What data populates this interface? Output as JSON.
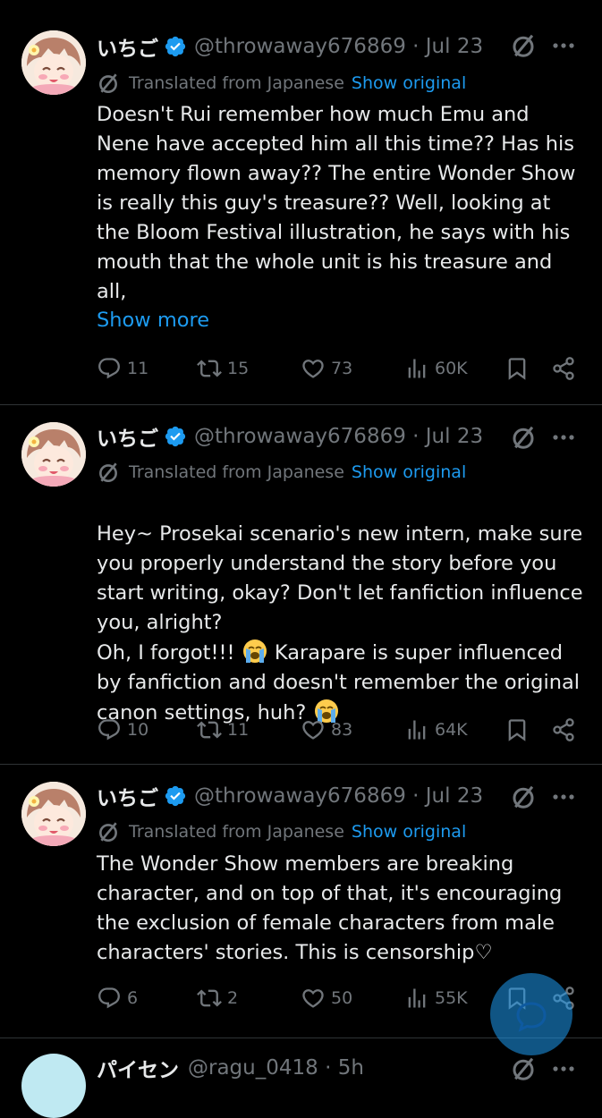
{
  "tweets": [
    {
      "name": "いちご",
      "handle": "@throwaway676869 · Jul 23",
      "translated": "Translated from Japanese",
      "show_original": "Show original",
      "body": "Doesn't Rui remember how much Emu and Nene have accepted him all this time?? Has his memory flown away?? The entire Wonder Show is really this guy's treasure?? Well, looking at the Bloom Festival illustration, he says with his mouth that the whole unit is his treasure and all,",
      "show_more": "Show more",
      "replies": "11",
      "reposts": "15",
      "likes": "73",
      "views": "60K"
    },
    {
      "name": "いちご",
      "handle": "@throwaway676869 · Jul 23",
      "translated": "Translated from Japanese",
      "show_original": "Show original",
      "body_a": "Hey~ Prosekai scenario's new intern, make sure you properly understand the story before you start writing, okay? Don't let fanfiction influence you, alright?",
      "body_b": "Oh, I forgot!!! ",
      "body_c": " Karapare is super influenced by fanfiction and doesn't remember the original canon settings, huh? ",
      "replies": "10",
      "reposts": "11",
      "likes": "83",
      "views": "64K"
    },
    {
      "name": "いちご",
      "handle": "@throwaway676869 · Jul 23",
      "translated": "Translated from Japanese",
      "show_original": "Show original",
      "body": "The Wonder Show members are breaking character, and on top of that, it's encouraging the exclusion of female characters from male characters' stories. This is censorship♡",
      "replies": "6",
      "reposts": "2",
      "likes": "50",
      "views": "55K"
    }
  ],
  "next_tweet": {
    "name": "パイセン",
    "handle": "@ragu_0418 · 5h"
  },
  "colors": {
    "accent": "#1d9bf0",
    "muted": "#71767b",
    "text": "#e7e9ea",
    "background": "#000000"
  }
}
